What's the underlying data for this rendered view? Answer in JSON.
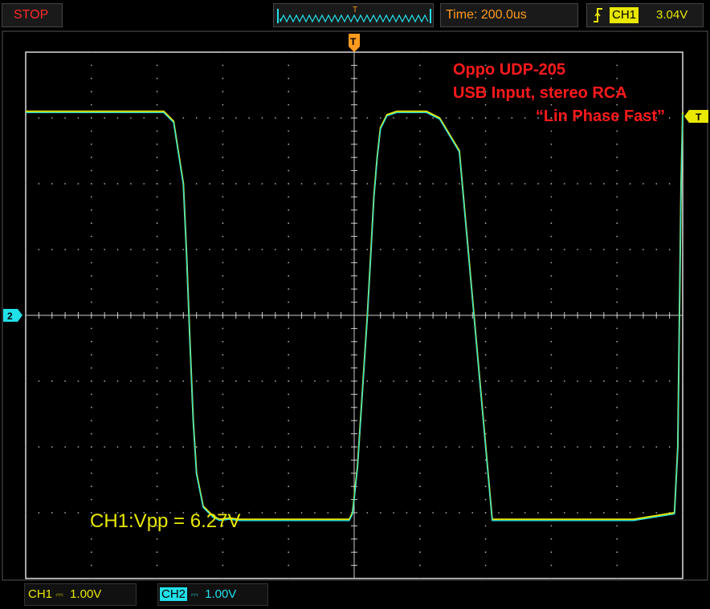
{
  "status": {
    "run_state": "STOP",
    "run_state_color": "#ff2a2a"
  },
  "timebase": {
    "label": "Time: 200.0us"
  },
  "trigger": {
    "channel": "CH1",
    "level": "3.04V",
    "marker_label": "T"
  },
  "channels": [
    {
      "name": "CH1",
      "coupling_icon": "dc-coupling-icon",
      "scale": "1.00V",
      "color": "#e8e800"
    },
    {
      "name": "CH2",
      "coupling_icon": "dc-coupling-icon",
      "scale": "1.00V",
      "color": "#22e0e8",
      "ground_marker": "2"
    }
  ],
  "annotations": {
    "line1": "Oppo UDP-205",
    "line2": "USB Input, stereo RCA",
    "line3": "“Lin Phase Fast”",
    "color": "#ff1a1a"
  },
  "measurement": {
    "text": "CH1:Vpp = 6.27V"
  },
  "chart_data": {
    "type": "line",
    "x_unit": "us",
    "y_unit": "V",
    "xlim": [
      -1000,
      1000
    ],
    "ylim": [
      -4,
      4
    ],
    "grid": true,
    "divisions": {
      "x": 10,
      "y": 8
    },
    "series": [
      {
        "name": "CH1",
        "color": "#e8e800",
        "x": [
          -1000,
          -580,
          -550,
          -520,
          -510,
          -500,
          -490,
          -480,
          -460,
          -430,
          -410,
          -380,
          -350,
          -320,
          -210,
          -190,
          -15,
          -5,
          10,
          40,
          50,
          60,
          70,
          80,
          100,
          130,
          160,
          190,
          220,
          260,
          320,
          420,
          470,
          850,
          975,
          985,
          995,
          1000
        ],
        "y": [
          3.1,
          3.1,
          2.95,
          2.0,
          0.9,
          -0.4,
          -1.6,
          -2.4,
          -2.9,
          -3.05,
          -3.1,
          -3.08,
          -3.1,
          -3.1,
          -3.1,
          -3.1,
          -3.1,
          -3.0,
          -2.3,
          0.0,
          0.9,
          1.8,
          2.4,
          2.85,
          3.05,
          3.1,
          3.1,
          3.1,
          3.1,
          3.0,
          2.5,
          -3.1,
          -3.1,
          -3.1,
          -3.0,
          -2.0,
          2.0,
          3.08
        ]
      },
      {
        "name": "CH2",
        "color": "#22e0e8",
        "x": [
          -1000,
          -580,
          -550,
          -520,
          -510,
          -500,
          -490,
          -480,
          -460,
          -430,
          -410,
          -380,
          -350,
          -320,
          -210,
          -190,
          -15,
          -5,
          10,
          40,
          50,
          60,
          70,
          80,
          100,
          130,
          160,
          190,
          220,
          260,
          320,
          420,
          470,
          850,
          975,
          985,
          995,
          1000
        ],
        "y": [
          3.08,
          3.08,
          2.93,
          1.98,
          0.88,
          -0.42,
          -1.62,
          -2.42,
          -2.92,
          -3.07,
          -3.12,
          -3.1,
          -3.12,
          -3.12,
          -3.12,
          -3.12,
          -3.12,
          -3.02,
          -2.32,
          -0.02,
          0.88,
          1.78,
          2.38,
          2.83,
          3.03,
          3.08,
          3.08,
          3.08,
          3.08,
          2.98,
          2.48,
          -3.12,
          -3.12,
          -3.12,
          -3.02,
          -2.02,
          1.98,
          3.06
        ]
      }
    ]
  }
}
